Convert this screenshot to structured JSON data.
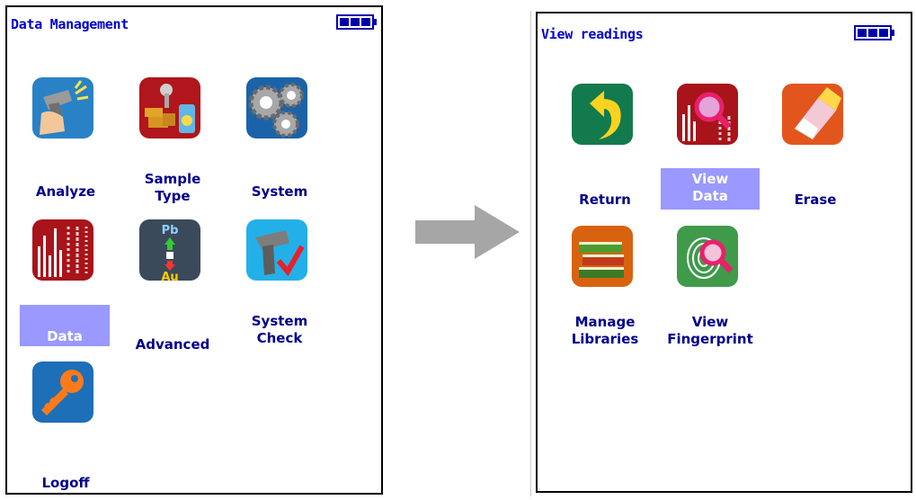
{
  "left": {
    "title": "Data Management",
    "tiles": [
      {
        "line1": "",
        "line2": "Analyze",
        "icon": "analyzer-gun-icon"
      },
      {
        "line1": "Sample",
        "line2": "Type",
        "icon": "sample-type-icon"
      },
      {
        "line1": "",
        "line2": "System",
        "icon": "gears-icon"
      },
      {
        "line1": "",
        "line2": "Data",
        "icon": "data-chart-icon",
        "selected": true
      },
      {
        "line1": "",
        "line2": "Advanced",
        "icon": "pb-au-icon"
      },
      {
        "line1": "System",
        "line2": "Check",
        "icon": "system-check-icon"
      },
      {
        "line1": "",
        "line2": "Logoff",
        "icon": "key-icon"
      }
    ]
  },
  "right": {
    "title": "View readings",
    "tiles": [
      {
        "line1": "",
        "line2": "Return",
        "icon": "return-arrow-icon"
      },
      {
        "line1": "View",
        "line2": "Data",
        "icon": "view-data-icon",
        "selected": true
      },
      {
        "line1": "",
        "line2": "Erase",
        "icon": "eraser-icon"
      },
      {
        "line1": "Manage",
        "line2": "Libraries",
        "icon": "books-icon"
      },
      {
        "line1": "View",
        "line2": "Fingerprint",
        "icon": "fingerprint-icon"
      }
    ]
  },
  "icon_text": {
    "pb": "Pb",
    "au": "Au"
  },
  "colors": {
    "title": "#0000cc",
    "label": "#00008b",
    "selection": "#9999ff",
    "arrow": "#a6a6a6"
  }
}
